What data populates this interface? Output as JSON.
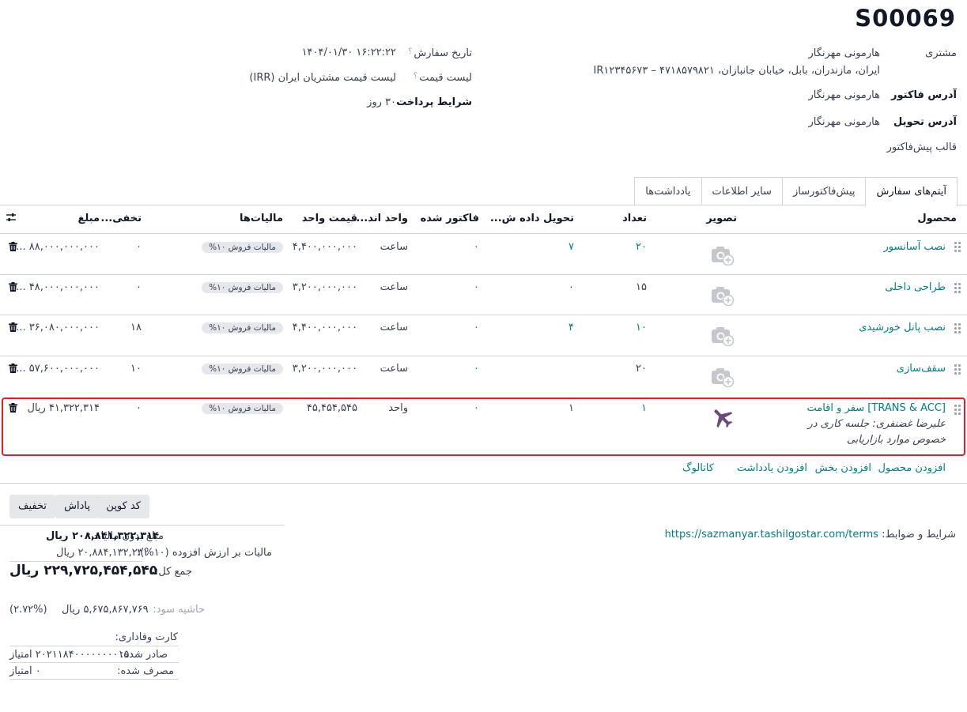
{
  "order": {
    "title": "S00069"
  },
  "customer": {
    "label": "مشتری",
    "name": "هارمونی مهرنگار",
    "address": "ایران، مازندران، بابل، خیابان جانبازان، ۴۷۱۸۵۷۹۸۲۱ – IR۱۲۳۴۵۶۷۳"
  },
  "invoice_address": {
    "label": "آدرس فاکتور",
    "value": "هارمونی مهرنگار"
  },
  "delivery_address": {
    "label": "آدرس تحویل",
    "value": "هارمونی مهرنگار"
  },
  "quotation_template": {
    "label": "قالب پیش‌فاکتور",
    "value": ""
  },
  "order_date": {
    "label": "تاریخ سفارش",
    "help": "؟",
    "value": "۱۶:۲۲:۲۲ ۱۴۰۴/۰۱/۳۰"
  },
  "pricelist": {
    "label": "لیست قیمت",
    "help": "؟",
    "value": "لیست قیمت مشتریان ایران (IRR)"
  },
  "payment_terms": {
    "label": "شرایط پرداخت",
    "value": "۳۰ روز"
  },
  "tabs": [
    {
      "label": "آیتم‌های سفارش",
      "active": true
    },
    {
      "label": "پیش‌فاکتورساز",
      "active": false
    },
    {
      "label": "سایر اطلاعات",
      "active": false
    },
    {
      "label": "یادداشت‌ها",
      "active": false
    }
  ],
  "columns": {
    "product": "محصول",
    "image": "تصویر",
    "quantity": "تعداد",
    "delivered": "تحویل داده ش...",
    "invoiced": "فاکتور شده",
    "uom": "واحد اند...",
    "unit_price": "قیمت واحد",
    "taxes": "مالیات‌ها",
    "discount": "تخفی...",
    "amount": "مبلغ"
  },
  "lines": [
    {
      "product": "نصب آسانسور",
      "description": "",
      "quantity": "۲۰",
      "delivered": "۷",
      "invoiced": "۰",
      "uom": "ساعت",
      "unit_price": "۴,۴۰۰,۰۰۰,۰۰۰",
      "tax": "مالیات فروش ۱۰%",
      "discount": "۰",
      "amount": "۸۸,۰۰۰,۰۰۰,۰۰۰ ...",
      "image": "camera-placeholder"
    },
    {
      "product": "طراحی داخلی",
      "description": "",
      "quantity": "۱۵",
      "delivered": "۰",
      "invoiced": "۰",
      "uom": "ساعت",
      "unit_price": "۳,۲۰۰,۰۰۰,۰۰۰",
      "tax": "مالیات فروش ۱۰%",
      "discount": "۰",
      "amount": "۴۸,۰۰۰,۰۰۰,۰۰۰ ...",
      "image": "camera-placeholder"
    },
    {
      "product": "نصب پانل خورشیدی",
      "description": "",
      "quantity": "۱۰",
      "delivered": "۴",
      "invoiced": "۰",
      "uom": "ساعت",
      "unit_price": "۴,۴۰۰,۰۰۰,۰۰۰",
      "tax": "مالیات فروش ۱۰%",
      "discount": "۱۸",
      "amount": "۳۶,۰۸۰,۰۰۰,۰۰۰ ...",
      "image": "camera-placeholder"
    },
    {
      "product": "سقف‌سازی",
      "description": "",
      "quantity": "۲۰",
      "delivered": "",
      "invoiced": "۰",
      "uom": "ساعت",
      "unit_price": "۳,۲۰۰,۰۰۰,۰۰۰",
      "tax": "مالیات فروش ۱۰%",
      "discount": "۱۰",
      "amount": "۵۷,۶۰۰,۰۰۰,۰۰۰ ...",
      "image": "camera-placeholder"
    },
    {
      "product": "[TRANS & ACC] سفر و اقامت",
      "description": "علیرضا غضنفری: جلسه کاری در خصوص موارد بازاریابی",
      "quantity": "۱",
      "delivered": "۱",
      "invoiced": "۰",
      "uom": "واحد",
      "unit_price": "۴۵,۴۵۴,۵۴۵",
      "tax": "مالیات فروش ۱۰%",
      "discount": "۰",
      "amount": "۴۱,۳۲۲,۳۱۴ ریال",
      "image": "airplane"
    }
  ],
  "add_links": {
    "add_product": "افزودن محصول",
    "add_section": "افزودن بخش",
    "add_note": "افزودن یادداشت",
    "catalog": "کاتالوگ"
  },
  "terms": {
    "label": "شرایط و ضوابط:",
    "url": "https://sazmanyar.tashilgostar.com/terms"
  },
  "buttons": {
    "coupon": "کد کوپن",
    "reward": "پاداش",
    "discount": "تخفیف"
  },
  "totals": {
    "untaxed_label": "مبلغ بدون مالیات:",
    "untaxed_value": "۲۰۸,۸۴۱,۳۲۲,۳۱۴ ریال",
    "vat_label": "مالیات بر ارزش افزوده (۱۰%):",
    "vat_value": "۲۰,۸۸۴,۱۳۲,۲۳۱ ریال",
    "total_label": "جمع کل:",
    "total_value": "۲۲۹,۷۲۵,۴۵۴,۵۴۵ ریال",
    "margin_label": "حاشیه سود:",
    "margin_value": "۵,۶۷۵,۸۶۷,۷۶۹ ریال",
    "margin_percent": "(۲.۷۲%)"
  },
  "loyalty": {
    "title": "کارت وفاداری:",
    "issued_label": "صادر شده:",
    "issued_value": "۲۰۲۱۱۸۴۰۰۰۰۰۰۰۰۱۵۰۰ امتیاز",
    "used_label": "مصرف شده:",
    "used_value": "۰ امتیاز"
  },
  "colors": {
    "link": "#017e84",
    "selected_border": "#e11d2a",
    "badge_bg": "#e5e7eb"
  }
}
